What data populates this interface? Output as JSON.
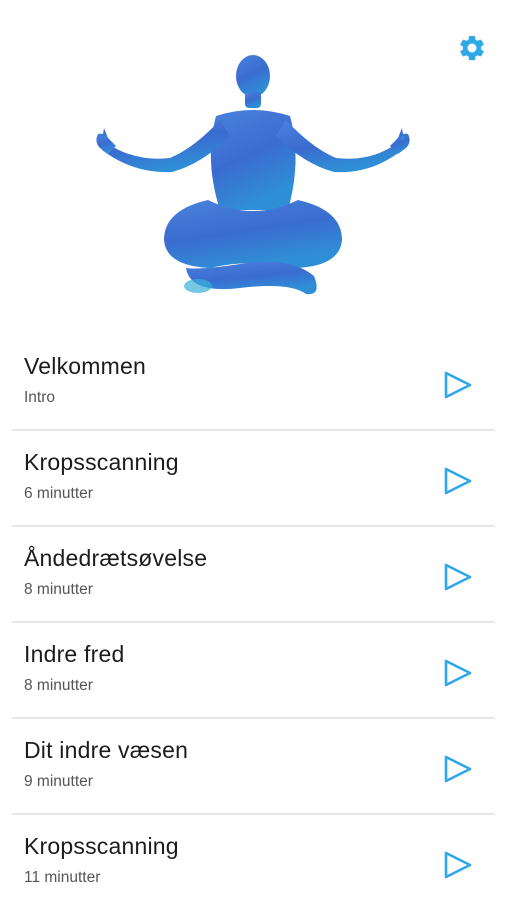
{
  "header": {
    "settings_icon": "gear-icon",
    "hero_icon": "meditation-figure-icon",
    "accent_color": "#2ea8e6",
    "figure_color": "#3b6fd1"
  },
  "items": [
    {
      "title": "Velkommen",
      "subtitle": "Intro",
      "icon": "play-icon"
    },
    {
      "title": "Kropsscanning",
      "subtitle": "6 minutter",
      "icon": "play-icon"
    },
    {
      "title": "Åndedrætsøvelse",
      "subtitle": "8 minutter",
      "icon": "play-icon"
    },
    {
      "title": "Indre fred",
      "subtitle": "8 minutter",
      "icon": "play-icon"
    },
    {
      "title": "Dit indre væsen",
      "subtitle": "9 minutter",
      "icon": "play-icon"
    },
    {
      "title": "Kropsscanning",
      "subtitle": "11 minutter",
      "icon": "play-icon"
    }
  ]
}
